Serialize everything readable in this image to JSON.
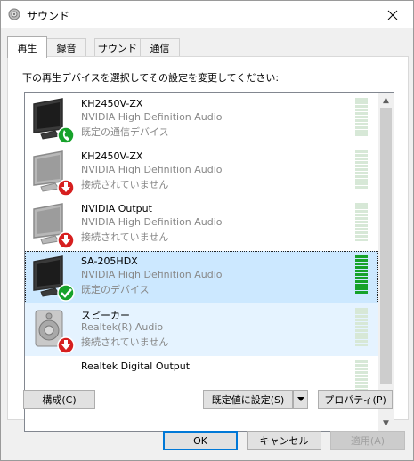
{
  "window": {
    "title": "サウンド"
  },
  "tabs": [
    {
      "label": "再生",
      "active": true
    },
    {
      "label": "録音",
      "active": false
    },
    {
      "label": "サウンド",
      "active": false
    },
    {
      "label": "通信",
      "active": false
    }
  ],
  "instruction": "下の再生デバイスを選択してその設定を変更してください:",
  "devices": [
    {
      "name": "KH2450V-ZX",
      "line2": "NVIDIA High Definition Audio",
      "line3": "既定の通信デバイス",
      "icon": "monitor-icon",
      "badge": "phone-badge-icon",
      "state": "normal"
    },
    {
      "name": "KH2450V-ZX",
      "line2": "NVIDIA High Definition Audio",
      "line3": "接続されていません",
      "icon": "monitor-icon",
      "badge": "down-arrow-badge-icon",
      "state": "normal"
    },
    {
      "name": "NVIDIA Output",
      "line2": "NVIDIA High Definition Audio",
      "line3": "接続されていません",
      "icon": "monitor-icon",
      "badge": "down-arrow-badge-icon",
      "state": "normal"
    },
    {
      "name": "SA-205HDX",
      "line2": "NVIDIA High Definition Audio",
      "line3": "既定のデバイス",
      "icon": "monitor-icon",
      "badge": "checkmark-badge-icon",
      "state": "selected"
    },
    {
      "name": "スピーカー",
      "line2": "Realtek(R) Audio",
      "line3": "接続されていません",
      "icon": "speaker-icon",
      "badge": "down-arrow-badge-icon",
      "state": "hover"
    },
    {
      "name": "Realtek Digital Output",
      "line2": "",
      "line3": "",
      "icon": "",
      "badge": "",
      "state": "normal"
    }
  ],
  "buttons": {
    "configure": "構成(C)",
    "set_default": "既定値に設定(S)",
    "properties": "プロパティ(P)",
    "ok": "OK",
    "cancel": "キャンセル",
    "apply": "適用(A)"
  },
  "colors": {
    "selected_bg": "#cce8ff",
    "hover_bg": "#e5f3ff",
    "meter_active": "#16a22a",
    "meter_idle": "#d7e8d7",
    "badge_green": "#16a22a",
    "badge_red": "#d61f1f"
  }
}
